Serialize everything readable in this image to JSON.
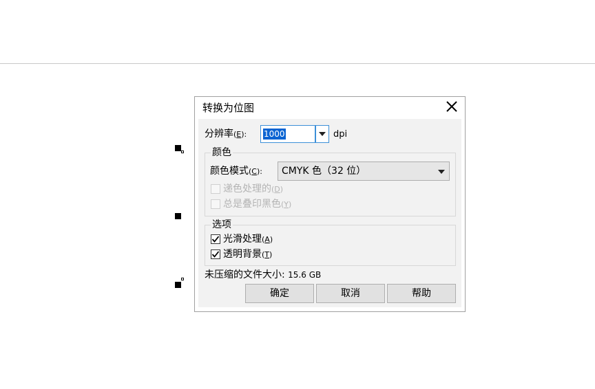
{
  "dialog": {
    "title": "转换为位图",
    "resolution": {
      "label": "分辨率",
      "mnemonic": "E",
      "value": "1000",
      "unit": "dpi"
    },
    "color_group": {
      "legend": "颜色",
      "mode_label": "颜色模式",
      "mode_mnemonic": "C",
      "mode_value": "CMYK 色（32 位）",
      "dither_label": "递色处理的",
      "dither_mnemonic": "D",
      "overprint_label": "总是叠印黑色",
      "overprint_mnemonic": "Y"
    },
    "options_group": {
      "legend": "选项",
      "antialias_label": "光滑处理",
      "antialias_mnemonic": "A",
      "transparent_label": "透明背景",
      "transparent_mnemonic": "T"
    },
    "filesize": {
      "label": "未压缩的文件大小:",
      "value": "15.6 GB"
    },
    "buttons": {
      "ok": "确定",
      "cancel": "取消",
      "help": "帮助"
    }
  }
}
